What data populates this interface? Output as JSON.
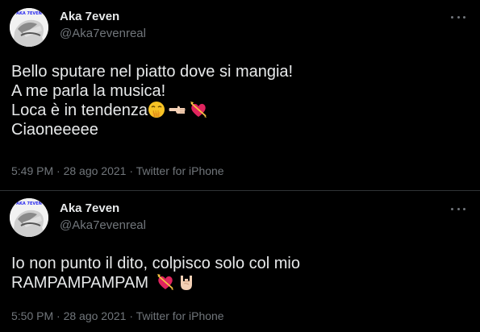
{
  "tweets": [
    {
      "author_name": "Aka 7even",
      "author_handle": "@Aka7evenreal",
      "avatar_label": "AKA 7EVEN",
      "lines": [
        "Bello sputare nel piatto dove si mangia!",
        "A me parla la musica!",
        "Loca è in tendenza",
        "Ciaoneeeee"
      ],
      "emoji_line_3": [
        "hand-over-mouth-emoji",
        "pointing-left-emoji",
        "heart-with-arrow-emoji"
      ],
      "time": "5:49 PM",
      "date": "28 ago 2021",
      "source": "Twitter for iPhone",
      "separator": "·"
    },
    {
      "author_name": "Aka 7even",
      "author_handle": "@Aka7evenreal",
      "avatar_label": "AKA 7EVEN",
      "lines": [
        "Io non punto il dito, colpisco solo col mio",
        "RAMPAMPAMPAM"
      ],
      "emoji_line_2": [
        "heart-with-arrow-emoji",
        "sign-of-horns-emoji"
      ],
      "time": "5:50 PM",
      "date": "28 ago 2021",
      "source": "Twitter for iPhone",
      "separator": "·"
    }
  ],
  "colors": {
    "background": "#000000",
    "text": "#e7e9ea",
    "secondary": "#71767b",
    "divider": "#2f3336"
  }
}
